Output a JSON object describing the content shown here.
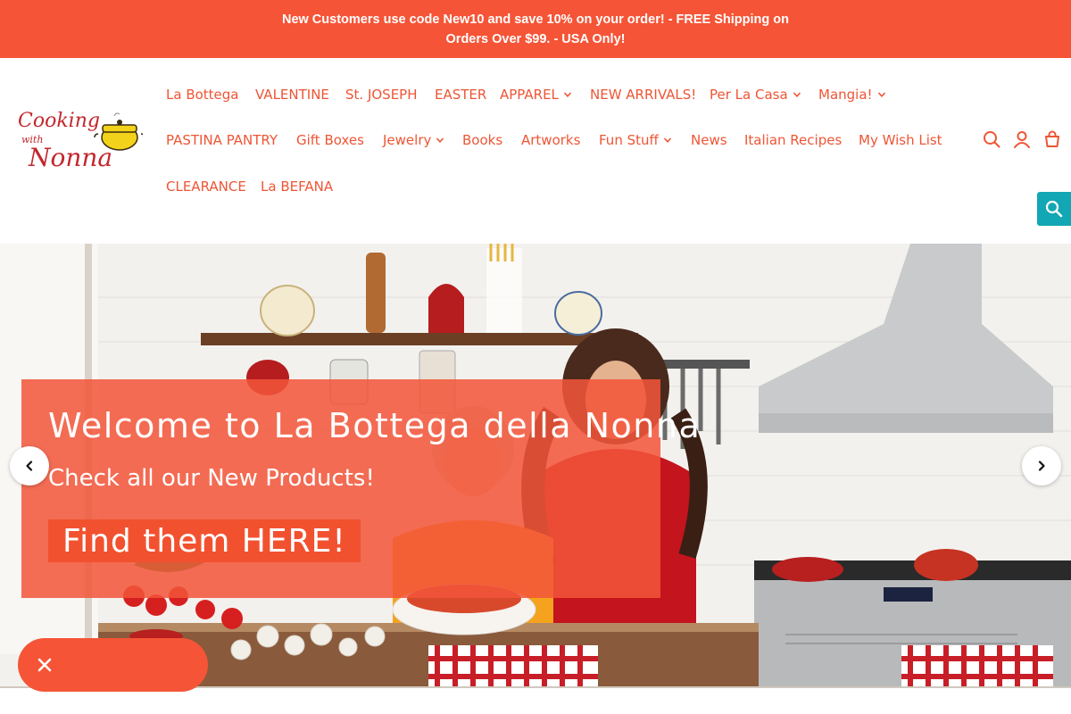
{
  "announcement": {
    "text": "New Customers use code New10 and save 10% on your order! - FREE Shipping on Orders Over $99. - USA Only!"
  },
  "brand": {
    "logo_text_1": "Cooking",
    "logo_text_2": "with",
    "logo_text_3": "Nonna",
    "accent_color": "#f55436",
    "teal_color": "#12a7b4"
  },
  "nav": {
    "items": [
      {
        "label": "La Bottega",
        "has_dropdown": false
      },
      {
        "label": "VALENTINE",
        "has_dropdown": false
      },
      {
        "label": "St. JOSEPH",
        "has_dropdown": false
      },
      {
        "label": "EASTER",
        "has_dropdown": false
      },
      {
        "label": "APPAREL",
        "has_dropdown": true
      },
      {
        "label": "NEW ARRIVALS!",
        "has_dropdown": false
      },
      {
        "label": "Per La Casa",
        "has_dropdown": true
      },
      {
        "label": "Mangia!",
        "has_dropdown": true
      },
      {
        "label": "PASTINA PANTRY",
        "has_dropdown": false
      },
      {
        "label": "Gift Boxes",
        "has_dropdown": false
      },
      {
        "label": "Jewelry",
        "has_dropdown": true
      },
      {
        "label": "Books",
        "has_dropdown": false
      },
      {
        "label": "Artworks",
        "has_dropdown": false
      },
      {
        "label": "Fun Stuff",
        "has_dropdown": true
      },
      {
        "label": "News",
        "has_dropdown": false
      },
      {
        "label": "Italian Recipes",
        "has_dropdown": false
      },
      {
        "label": "My Wish List",
        "has_dropdown": false
      },
      {
        "label": "CLEARANCE",
        "has_dropdown": false
      },
      {
        "label": "La BEFANA",
        "has_dropdown": false
      }
    ]
  },
  "header_icons": [
    "search-icon",
    "account-icon",
    "cart-icon"
  ],
  "hero": {
    "title": "Welcome to La Bottega della Nonna",
    "subtitle": "Check all our New Products!",
    "cta": "Find them HERE!"
  }
}
